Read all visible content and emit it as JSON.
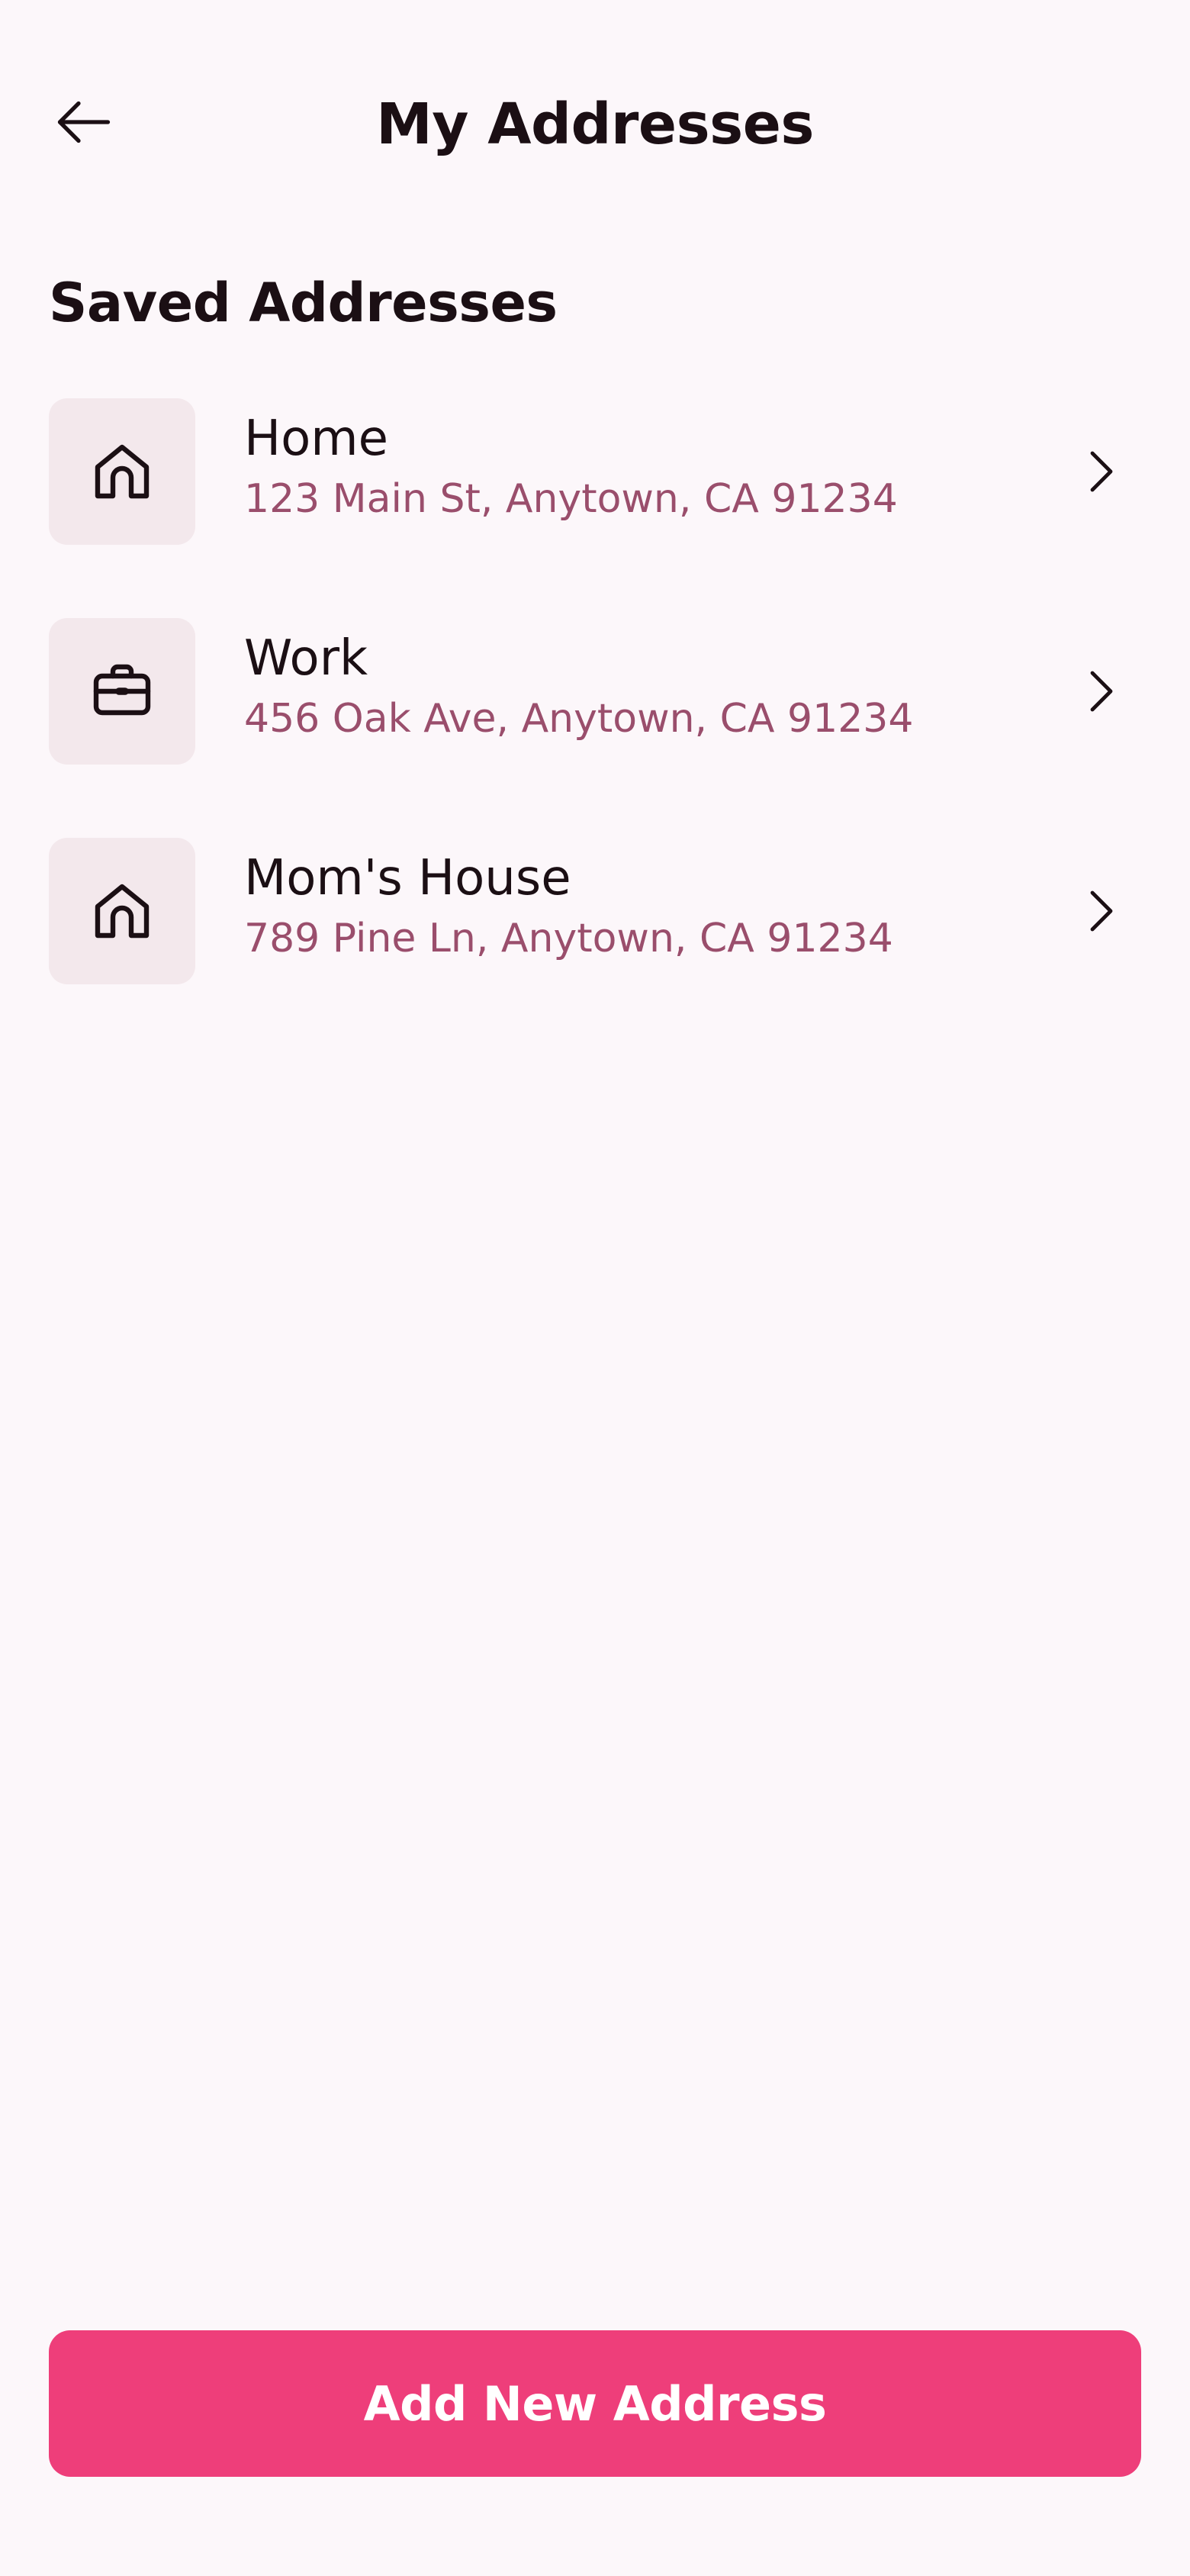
{
  "header": {
    "title": "My Addresses",
    "back_icon": "arrow-left-icon"
  },
  "section": {
    "title": "Saved Addresses"
  },
  "addresses": [
    {
      "label": "Home",
      "address": "123 Main St, Anytown, CA 91234",
      "icon": "home-icon"
    },
    {
      "label": "Work",
      "address": "456 Oak Ave, Anytown, CA 91234",
      "icon": "briefcase-icon"
    },
    {
      "label": "Mom's House",
      "address": "789 Pine Ln, Anytown, CA 91234",
      "icon": "home-icon"
    }
  ],
  "actions": {
    "add_label": "Add New Address"
  },
  "colors": {
    "background": "#fcf7fa",
    "text_primary": "#1b0f14",
    "text_secondary": "#9a4e6c",
    "icon_tile": "#f3e8ec",
    "accent": "#ee3e7a"
  }
}
